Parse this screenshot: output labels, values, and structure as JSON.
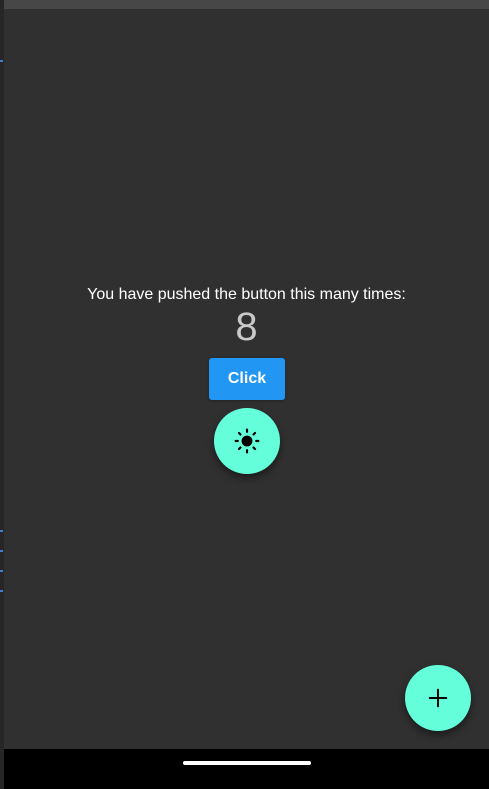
{
  "main": {
    "headline": "You have pushed the button this many times:",
    "counter": "8",
    "click_label": "Click"
  },
  "icons": {
    "theme_toggle": "brightness-icon",
    "add": "plus-icon"
  },
  "colors": {
    "background": "#303030",
    "click_button": "#2196f3",
    "fab": "#64ffda"
  }
}
